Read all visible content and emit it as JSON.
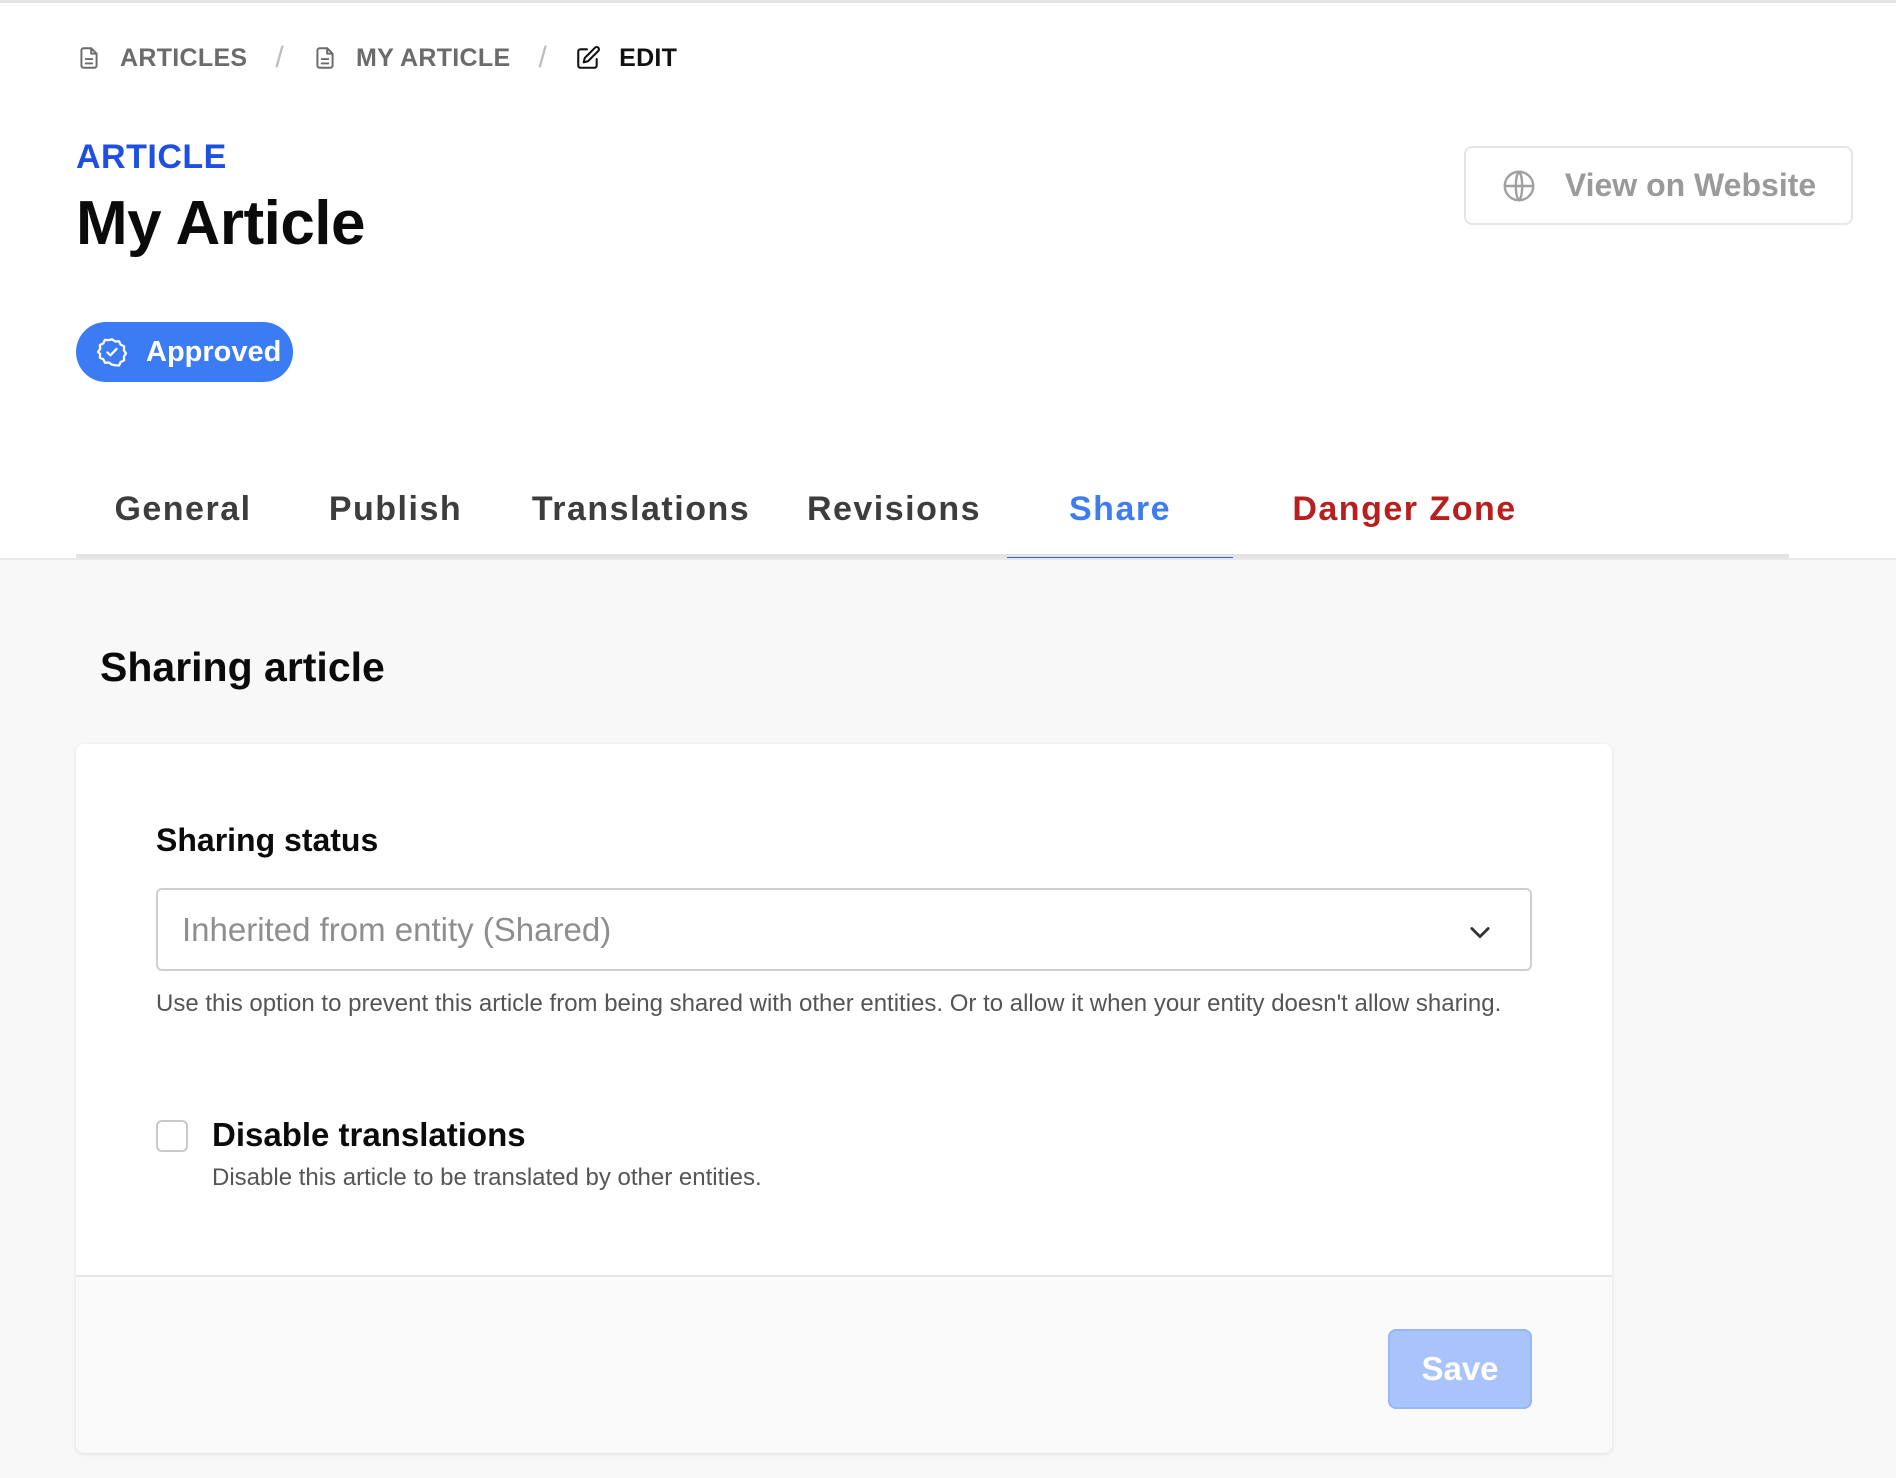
{
  "breadcrumb": {
    "items": [
      {
        "label": "ARTICLES",
        "icon": "document-icon"
      },
      {
        "label": "MY ARTICLE",
        "icon": "document-icon"
      },
      {
        "label": "EDIT",
        "icon": "edit-icon"
      }
    ],
    "separator": "/"
  },
  "header": {
    "eyebrow": "ARTICLE",
    "title": "My Article",
    "view_button_label": "View on Website",
    "view_button_icon": "globe-icon",
    "status_badge": {
      "label": "Approved",
      "icon": "check-badge-icon",
      "color": "#3b7bf3"
    }
  },
  "tabs": [
    {
      "label": "General",
      "active": false
    },
    {
      "label": "Publish",
      "active": false
    },
    {
      "label": "Translations",
      "active": false
    },
    {
      "label": "Revisions",
      "active": false
    },
    {
      "label": "Share",
      "active": true
    },
    {
      "label": "Danger Zone",
      "active": false
    }
  ],
  "section": {
    "title": "Sharing article",
    "sharing_status": {
      "label": "Sharing status",
      "selected": "Inherited from entity (Shared)",
      "help": "Use this option to prevent this article from being shared with other entities. Or to allow it when your entity doesn't allow sharing."
    },
    "disable_translations": {
      "label": "Disable translations",
      "help": "Disable this article to be translated by other entities.",
      "checked": false
    },
    "save_label": "Save"
  },
  "colors": {
    "accent": "#1f4fe0",
    "active_tab": "#3f7cf0",
    "danger": "#b81f1f",
    "save_disabled": "#a9c4fa"
  }
}
